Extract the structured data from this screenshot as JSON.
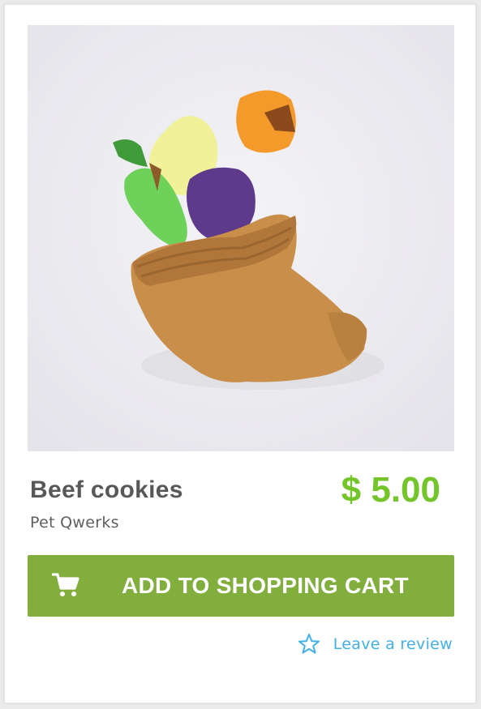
{
  "product": {
    "name": "Beef cookies",
    "brand": "Pet Qwerks",
    "price": "$ 5.00",
    "image_icon": "cornucopia-plush-toy-image"
  },
  "actions": {
    "add_to_cart_label": "ADD TO SHOPPING CART",
    "add_to_cart_icon": "shopping-cart-icon",
    "review_label": "Leave a review",
    "review_icon": "star-outline-icon"
  },
  "colors": {
    "price": "#73c52a",
    "button_bg": "#82ae3e",
    "link": "#3fb1e6",
    "title": "#585858"
  }
}
